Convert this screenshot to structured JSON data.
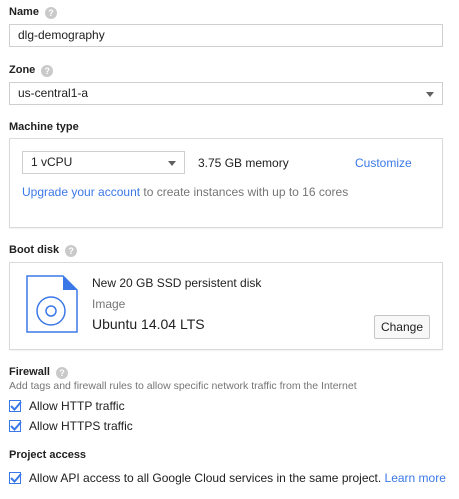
{
  "name": {
    "label": "Name",
    "value": "dlg-demography"
  },
  "zone": {
    "label": "Zone",
    "value": "us-central1-a"
  },
  "machine_type": {
    "label": "Machine type",
    "cpu_value": "1 vCPU",
    "memory": "3.75 GB memory",
    "customize_label": "Customize",
    "upgrade_link": "Upgrade your account",
    "upgrade_text": " to create instances with up to 16 cores"
  },
  "boot_disk": {
    "label": "Boot disk",
    "title": "New 20 GB SSD persistent disk",
    "image_label": "Image",
    "image_value": "Ubuntu 14.04 LTS",
    "change_label": "Change"
  },
  "firewall": {
    "label": "Firewall",
    "description": "Add tags and firewall rules to allow specific network traffic from the Internet",
    "http_label": "Allow HTTP traffic",
    "http_checked": true,
    "https_label": "Allow HTTPS traffic",
    "https_checked": true
  },
  "project_access": {
    "label": "Project access",
    "api_label": "Allow API access to all Google Cloud services in the same project.",
    "api_checked": true,
    "learn_more": "Learn more"
  },
  "colors": {
    "accent": "#3b78e7",
    "disk_icon": "#3b78e7"
  }
}
